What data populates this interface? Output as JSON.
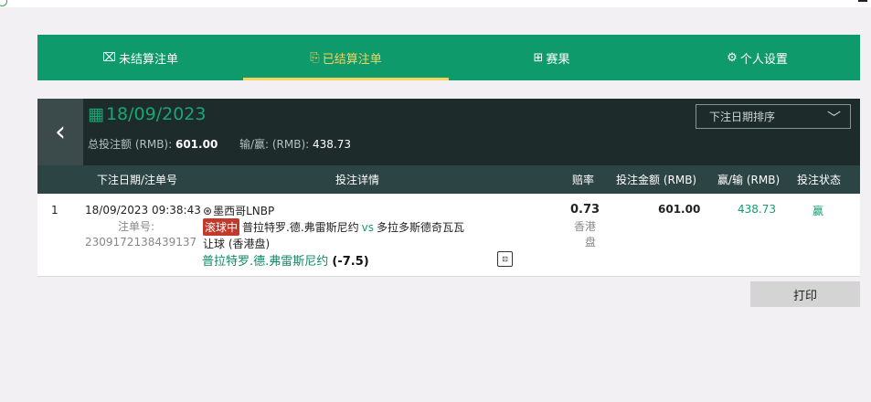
{
  "tabs": [
    {
      "icon": "⌧",
      "label": "未结算注单"
    },
    {
      "icon": "⎘",
      "label": "已结算注单"
    },
    {
      "icon": "⊞",
      "label": "赛果"
    },
    {
      "icon": "⚙",
      "label": "个人设置"
    }
  ],
  "summary": {
    "date": "18/09/2023",
    "total_stake_label": "总投注额 (RMB):",
    "total_stake": "601.00",
    "winloss_label": "输/赢: (RMB):",
    "winloss": "438.73",
    "sort_label": "下注日期排序"
  },
  "table": {
    "headers": {
      "date_betno": "下注日期/注单号",
      "details": "投注详情",
      "odds": "赔率",
      "stake": "投注金额 (RMB)",
      "winloss": "赢/输 (RMB)",
      "status": "投注状态"
    },
    "rows": [
      {
        "index": "1",
        "datetime": "18/09/2023 09:38:43",
        "bet_no_label": "注单号:",
        "bet_no": "2309172138439137",
        "league": "墨西哥LNBP",
        "live_badge": "滚球中",
        "home_team": "普拉特罗.德.弗雷斯尼约",
        "vs": "vs",
        "away_team": "多拉多斯德奇瓦瓦",
        "bet_type": "让球 (香港盘)",
        "selection": "普拉特罗.德.弗雷斯尼约",
        "handicap": "(-7.5)",
        "odds": "0.73",
        "odds_type": "香港盘",
        "stake": "601.00",
        "winloss": "438.73",
        "status": "赢"
      }
    ]
  },
  "print_label": "打印",
  "colors": {
    "accent_green": "#0f9a6b",
    "active_tab": "#f4d35e",
    "header_dark": "#1e2b2b",
    "live_red": "#c0392b"
  }
}
